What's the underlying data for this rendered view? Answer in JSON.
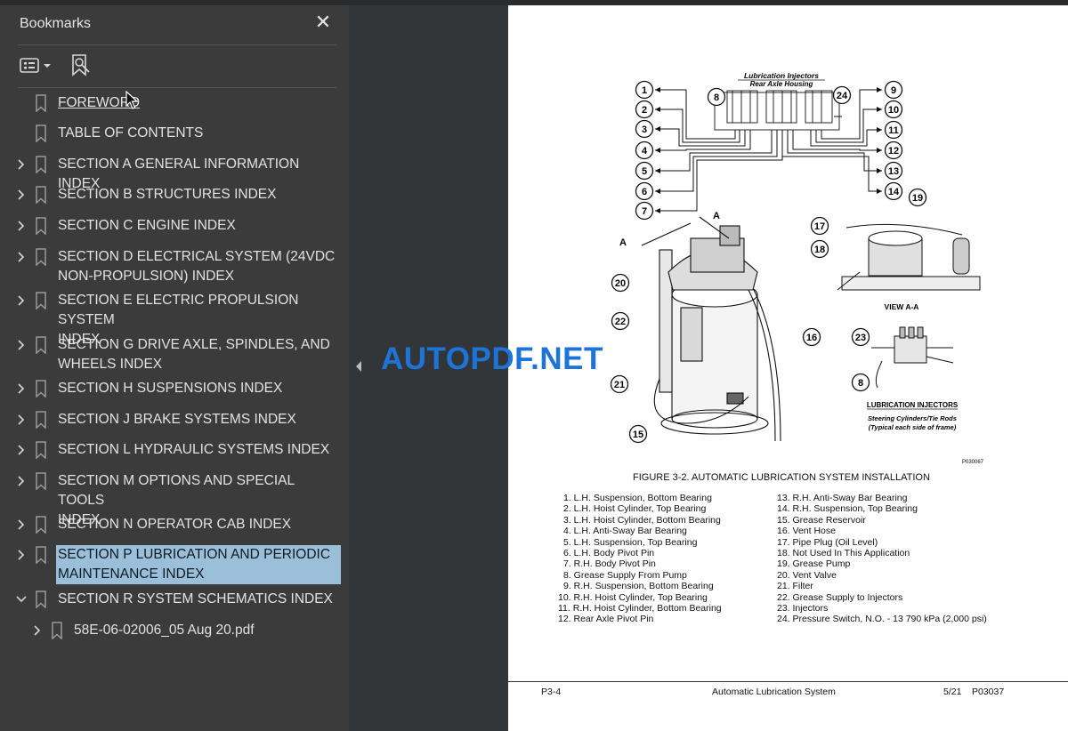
{
  "bookmarks_panel": {
    "title": "Bookmarks",
    "close_glyph": "✕",
    "items": [
      {
        "label": "FOREWORD",
        "expandable": false,
        "underlined": true
      },
      {
        "label": "TABLE OF CONTENTS",
        "expandable": false
      },
      {
        "label": "SECTION A GENERAL INFORMATION INDEX",
        "expandable": true
      },
      {
        "label": "SECTION B STRUCTURES INDEX",
        "expandable": true
      },
      {
        "label": "SECTION C ENGINE INDEX",
        "expandable": true
      },
      {
        "label_lines": [
          "SECTION D ELECTRICAL SYSTEM (24VDC",
          "NON-PROPULSION) INDEX"
        ],
        "expandable": true
      },
      {
        "label_lines": [
          "SECTION E ELECTRIC PROPULSION SYSTEM",
          "INDEX"
        ],
        "expandable": true
      },
      {
        "label_lines": [
          "SECTION G DRIVE AXLE, SPINDLES, AND",
          "WHEELS INDEX"
        ],
        "expandable": true
      },
      {
        "label": "SECTION H SUSPENSIONS INDEX",
        "expandable": true
      },
      {
        "label": "SECTION J BRAKE SYSTEMS INDEX",
        "expandable": true
      },
      {
        "label": "SECTION L HYDRAULIC SYSTEMS INDEX",
        "expandable": true
      },
      {
        "label_lines": [
          "SECTION M OPTIONS AND SPECIAL TOOLS",
          "INDEX"
        ],
        "expandable": true
      },
      {
        "label": "SECTION N OPERATOR CAB INDEX",
        "expandable": true
      },
      {
        "label_lines": [
          "SECTION P LUBRICATION AND PERIODIC",
          "MAINTENANCE INDEX"
        ],
        "expandable": true,
        "selected": true
      },
      {
        "label": "SECTION R SYSTEM SCHEMATICS INDEX",
        "expandable": true,
        "expanded": true
      },
      {
        "label": "58E-06-02006_05 Aug 20.pdf",
        "expandable": true,
        "child": true
      }
    ],
    "icons": [
      "options-menu-icon",
      "find-bookmark-icon",
      "bookmark-flag-icon",
      "chevron-right-icon",
      "chevron-down-icon"
    ]
  },
  "watermark": "AUTOPDF.NET",
  "document_page": {
    "diagram": {
      "top_label_1": "Lubrication Injectors",
      "top_label_2": "Rear Axle Housing",
      "view_label": "VIEW A-A",
      "section_marker": "A",
      "inj_label": "LUBRICATION INJECTORS",
      "inj_sub_1": "Steering Cylinders/Tie Rods",
      "inj_sub_2": "(Typical each side of frame)",
      "code": "P030067",
      "callouts": [
        "1",
        "2",
        "3",
        "4",
        "5",
        "6",
        "7",
        "8",
        "9",
        "10",
        "11",
        "12",
        "13",
        "14",
        "15",
        "16",
        "17",
        "18",
        "19",
        "20",
        "21",
        "22",
        "23",
        "24"
      ]
    },
    "figure_caption": "FIGURE 3-2. AUTOMATIC LUBRICATION SYSTEM INSTALLATION",
    "legend_left": [
      "1. L.H. Suspension, Bottom Bearing",
      "2. L.H. Hoist Cylinder, Top Bearing",
      "3. L.H. Hoist Cylinder, Bottom Bearing",
      "4. L.H. Anti-Sway Bar Bearing",
      "5. L.H. Suspension, Top Bearing",
      "6. L.H. Body Pivot Pin",
      "7. R.H. Body Pivot Pin",
      "8. Grease Supply From Pump",
      "9. R.H. Suspension, Bottom Bearing",
      "10. R.H. Hoist Cylinder, Top Bearing",
      "11. R.H. Hoist Cylinder, Bottom Bearing",
      "12. Rear Axle Pivot Pin"
    ],
    "legend_right": [
      "13. R.H. Anti-Sway Bar Bearing",
      "14. R.H. Suspension, Top Bearing",
      "15. Grease Reservoir",
      "16. Vent Hose",
      "17. Pipe Plug (Oil Level)",
      "18. Not Used In This Application",
      "19. Grease Pump",
      "20. Vent Valve",
      "21. Filter",
      "22. Grease Supply to Injectors",
      "23. Injectors",
      "24. Pressure Switch, N.O. - 13 790 kPa (2,000 psi)"
    ],
    "footer": {
      "page": "P3-4",
      "title": "Automatic Lubrication System",
      "date": "5/21",
      "doc": "P03037"
    }
  }
}
